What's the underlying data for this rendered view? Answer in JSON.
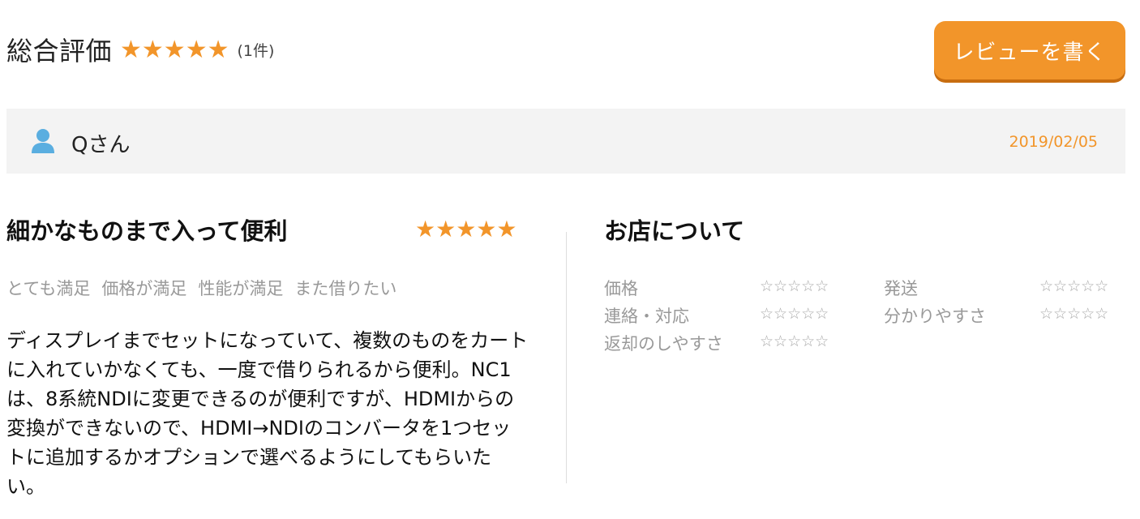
{
  "header": {
    "title": "総合評価",
    "stars": "★★★★★",
    "count": "(1件)",
    "write_review_label": "レビューを書く"
  },
  "reviewer": {
    "name": "Qさん",
    "date": "2019/02/05",
    "icon": "user-icon"
  },
  "review": {
    "title": "細かなものまで入って便利",
    "stars": "★★★★★",
    "tags": [
      "とても満足",
      "価格が満足",
      "性能が満足",
      "また借りたい"
    ],
    "body": "ディスプレイまでセットになっていて、複数のものをカートに入れていかなくても、一度で借りられるから便利。NC1は、8系統NDIに変更できるのが便利ですが、HDMIからの変換ができないので、HDMI→NDIのコンバータを1つセットに追加するかオプションで選べるようにしてもらいたい。"
  },
  "shop": {
    "title": "お店について",
    "ratings": [
      {
        "label": "価格",
        "stars": "☆☆☆☆☆"
      },
      {
        "label": "発送",
        "stars": "☆☆☆☆☆"
      },
      {
        "label": "連絡・対応",
        "stars": "☆☆☆☆☆"
      },
      {
        "label": "分かりやすさ",
        "stars": "☆☆☆☆☆"
      },
      {
        "label": "返却のしやすさ",
        "stars": "☆☆☆☆☆"
      }
    ]
  },
  "colors": {
    "accent": "#f2952a",
    "user_icon": "#5aaee0",
    "bar_bg": "#f3f3f3"
  }
}
